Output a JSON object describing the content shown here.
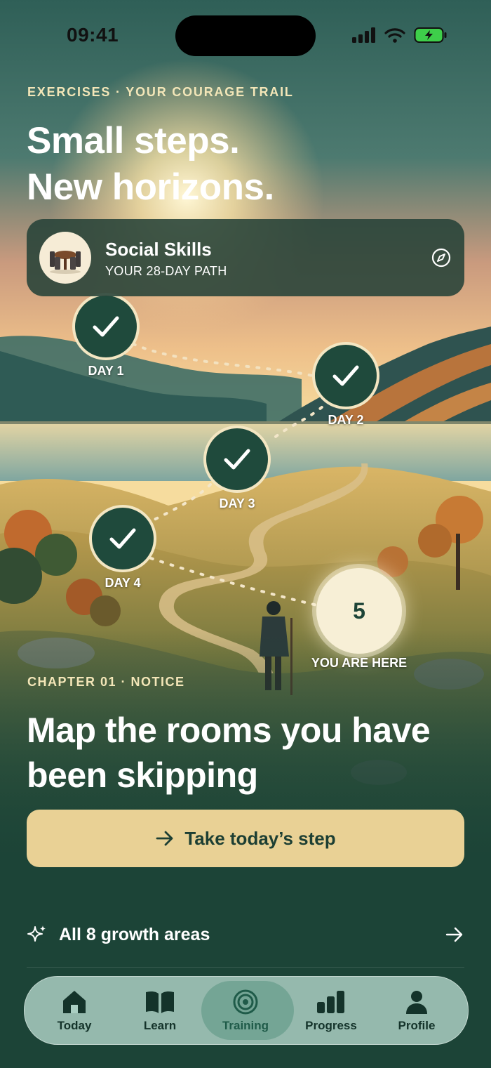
{
  "status_bar": {
    "time": "09:41"
  },
  "header": {
    "eyebrow": "EXERCISES · YOUR COURAGE TRAIL",
    "title_line1": "Small steps.",
    "title_line2": "New horizons."
  },
  "program": {
    "title": "Social Skills",
    "subtitle": "YOUR 28-DAY PATH",
    "icon": "compass-icon"
  },
  "trail": {
    "days": [
      {
        "label": "DAY 1",
        "status": "completed"
      },
      {
        "label": "DAY 2",
        "status": "completed"
      },
      {
        "label": "DAY 3",
        "status": "completed"
      },
      {
        "label": "DAY 4",
        "status": "completed"
      }
    ],
    "current": {
      "number": "5",
      "label": "YOU ARE HERE"
    }
  },
  "chapter": {
    "eyebrow": "CHAPTER 01 · NOTICE",
    "title": "Map the rooms you have been skipping"
  },
  "cta": {
    "label": "Take today’s step"
  },
  "growth": {
    "label": "All 8 growth areas"
  },
  "tabbar": {
    "tabs": [
      {
        "label": "Today",
        "icon": "home-icon"
      },
      {
        "label": "Learn",
        "icon": "book-icon"
      },
      {
        "label": "Training",
        "icon": "target-icon",
        "active": true
      },
      {
        "label": "Progress",
        "icon": "bar-chart-icon"
      },
      {
        "label": "Profile",
        "icon": "user-icon"
      }
    ]
  },
  "colors": {
    "brand_dark": "#1d4437",
    "cream": "#f3e6b8",
    "cta": "#e9d195",
    "badge": "#1f4a3c"
  }
}
